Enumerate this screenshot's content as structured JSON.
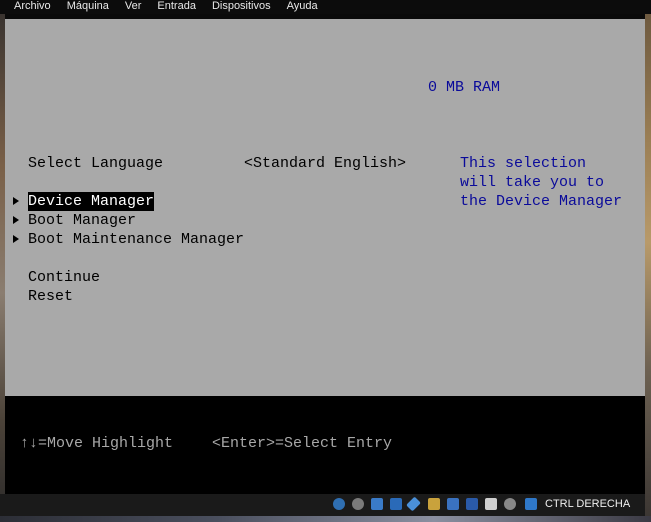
{
  "menu": [
    "Archivo",
    "Máquina",
    "Ver",
    "Entrada",
    "Dispositivos",
    "Ayuda"
  ],
  "bios": {
    "ram": "0 MB RAM",
    "select_language_label": "Select Language",
    "language_value": "<Standard English>",
    "menu_items": [
      "Device Manager",
      "Boot Manager",
      "Boot Maintenance Manager"
    ],
    "continue": "Continue",
    "reset": "Reset",
    "help_text": "This selection will take you to the Device Manager",
    "footer_move": "↑↓=Move Highlight",
    "footer_enter": "<Enter>=Select Entry"
  },
  "statusbar": {
    "host_key": "CTRL DERECHA",
    "icons": [
      "hard-disk-icon",
      "optical-drive-icon",
      "audio-icon",
      "network-icon",
      "usb-icon",
      "shared-folders-icon",
      "display-icon",
      "video-capture-icon",
      "cpu-icon",
      "mouse-integration-icon",
      "keyboard-capture-icon"
    ]
  },
  "colors": {
    "bios_bg": "#a9a9a9",
    "bios_help_text": "#0a0a9a",
    "footer_bg": "#000000"
  }
}
